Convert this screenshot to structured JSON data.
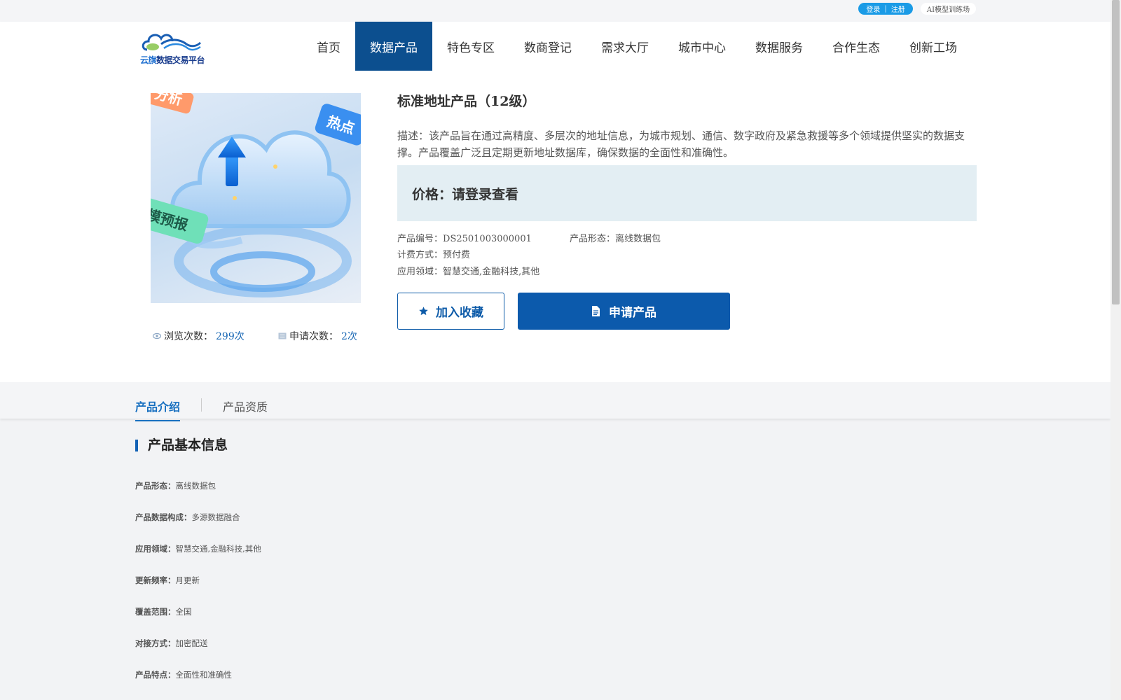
{
  "topbar": {
    "login": "登录",
    "separator": "|",
    "register": "注册",
    "ai_training": "AI模型训练场"
  },
  "logo": {
    "text_part1": "云旗",
    "text_part2": "数据交易平台"
  },
  "nav": {
    "items": [
      {
        "label": "首页"
      },
      {
        "label": "数据产品",
        "active": true
      },
      {
        "label": "特色专区"
      },
      {
        "label": "数商登记"
      },
      {
        "label": "需求大厅"
      },
      {
        "label": "城市中心"
      },
      {
        "label": "数据服务"
      },
      {
        "label": "合作生态"
      },
      {
        "label": "创新工场"
      }
    ]
  },
  "product": {
    "image_labels": [
      "分析",
      "热点",
      "模预报"
    ],
    "title": "标准地址产品（12级）",
    "description": "描述：该产品旨在通过高精度、多层次的地址信息，为城市规划、通信、数字政府及紧急救援等多个领域提供坚实的数据支撑。产品覆盖广泛且定期更新地址数据库，确保数据的全面性和准确性。",
    "price": "价格：请登录查看",
    "code_label": "产品编号：",
    "code_value": "DS2501003000001",
    "form_label": "产品形态：",
    "form_value": "离线数据包",
    "billing_label": "计费方式：",
    "billing_value": "预付费",
    "domain_label": "应用领域：",
    "domain_value": "智慧交通,金融科技,其他",
    "views_label": "浏览次数：",
    "views_value": "299次",
    "applies_label": "申请次数：",
    "applies_value": "2次",
    "favorite_button": "加入收藏",
    "apply_button": "申请产品"
  },
  "tabs": [
    {
      "label": "产品介绍",
      "active": true
    },
    {
      "label": "产品资质"
    }
  ],
  "basic_info": {
    "title": "产品基本信息",
    "rows": [
      {
        "label": "产品形态：",
        "value": "离线数据包"
      },
      {
        "label": "产品数据构成：",
        "value": "多源数据融合"
      },
      {
        "label": "应用领域：",
        "value": "智慧交通,金融科技,其他"
      },
      {
        "label": "更新频率：",
        "value": "月更新"
      },
      {
        "label": "覆盖范围：",
        "value": "全国"
      },
      {
        "label": "对接方式：",
        "value": "加密配送"
      },
      {
        "label": "产品特点：",
        "value": "全面性和准确性"
      }
    ]
  },
  "colors": {
    "primary": "#0c5aac",
    "nav_active": "#0c4f8f",
    "accent_blue": "#1870c0",
    "price_bg": "#e3eef3"
  }
}
